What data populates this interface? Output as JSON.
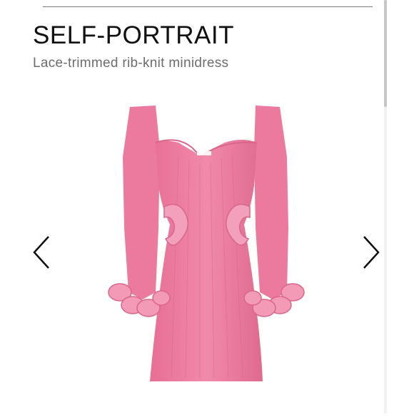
{
  "product": {
    "brand": "SELF-PORTRAIT",
    "title": "Lace-trimmed rib-knit minidress"
  },
  "gallery": {
    "image_alt": "Pink lace-trimmed rib-knit minidress",
    "prev_icon": "chevron-left-icon",
    "next_icon": "chevron-right-icon"
  },
  "colors": {
    "dress": "#ec7a9e",
    "dress_shadow": "#d9668b",
    "text_primary": "#111111",
    "text_secondary": "#6d6d6d"
  }
}
